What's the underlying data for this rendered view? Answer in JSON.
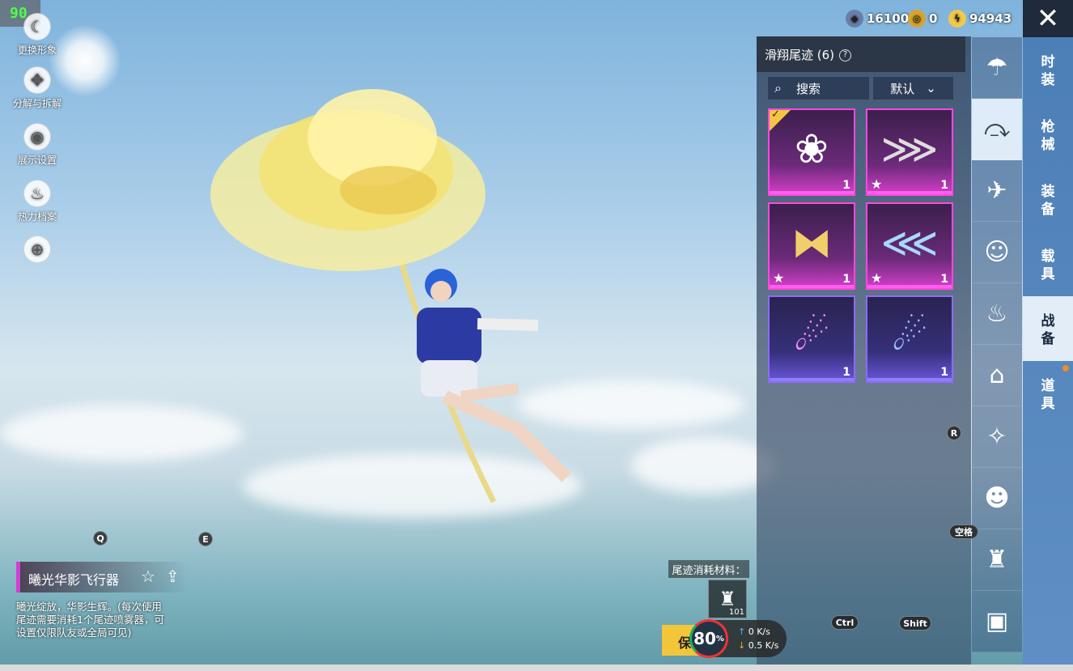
{
  "fps": "90",
  "left_tools": [
    {
      "label": "更换形象",
      "icon": "moon-icon"
    },
    {
      "label": "分解与拆解",
      "icon": "puzzle-icon"
    },
    {
      "label": "展示设置",
      "icon": "eye-icon"
    },
    {
      "label": "热力档案",
      "icon": "flame-icon"
    },
    {
      "label": "",
      "icon": "plus-circle-icon"
    }
  ],
  "currencies": [
    {
      "value": "16100",
      "color": "#6a7fa8",
      "icon": "gem-coin-icon"
    },
    {
      "value": "0",
      "color": "#d9a42a",
      "icon": "token-coin-icon"
    },
    {
      "value": "94943",
      "color": "#f2c94c",
      "icon": "bp-coin-icon"
    }
  ],
  "panel": {
    "title": "滑翔尾迹 (6)",
    "search_label": "搜索",
    "sort_label": "默认"
  },
  "items": [
    {
      "count": "1",
      "rarity": "legendary",
      "equipped": true,
      "starred": false,
      "icon": "flower-icon"
    },
    {
      "count": "1",
      "rarity": "legendary",
      "equipped": false,
      "starred": true,
      "icon": "wings-silver-icon"
    },
    {
      "count": "1",
      "rarity": "legendary",
      "equipped": false,
      "starred": true,
      "icon": "butterfly-gold-icon"
    },
    {
      "count": "1",
      "rarity": "legendary",
      "equipped": false,
      "starred": true,
      "icon": "wings-ice-icon"
    },
    {
      "count": "1",
      "rarity": "epic",
      "equipped": false,
      "starred": false,
      "icon": "rainbow-trail-icon"
    },
    {
      "count": "1",
      "rarity": "epic",
      "equipped": false,
      "starred": false,
      "icon": "smoke-trail-icon"
    }
  ],
  "categories": [
    "parachute-icon",
    "glider-trail-icon",
    "plane-icon",
    "face-icon",
    "chicken-icon",
    "backpack-icon",
    "sparkle-icon",
    "emote-icon",
    "spray-icon",
    "photo-icon"
  ],
  "tabs": [
    "时\n装",
    "枪\n械",
    "装\n备",
    "载\n具",
    "战\n备",
    "道\n具"
  ],
  "key_hints": {
    "q": "Q",
    "e": "E",
    "r": "R",
    "space": "空格",
    "ctrl": "Ctrl",
    "shift": "Shift"
  },
  "selected_item": {
    "name": "曦光华影飞行器",
    "description": "曦光绽放，华影生辉。(每次使用尾迹需要消耗1个尾迹喷雾器，可设置仅限队友或全局可见)"
  },
  "material": {
    "label": "尾迹消耗材料：",
    "count": "101"
  },
  "save_label": "保",
  "network": {
    "percent": "80",
    "up": "0 K/s",
    "down": "0.5 K/s"
  }
}
